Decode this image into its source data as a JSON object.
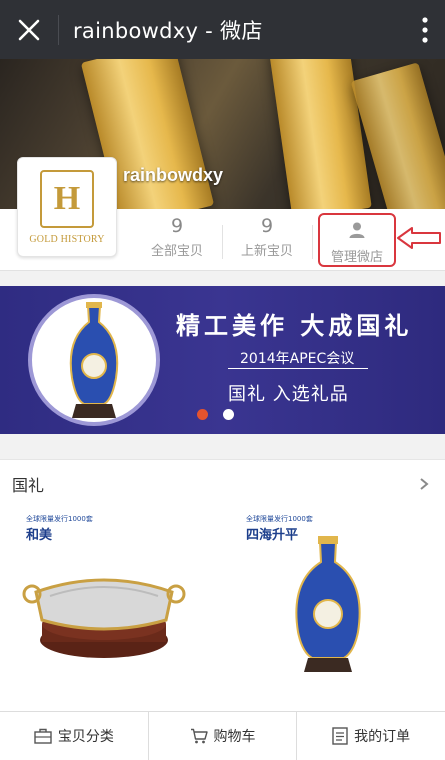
{
  "titlebar": {
    "title": "rainbowdxy - 微店"
  },
  "shop": {
    "name": "rainbowdxy",
    "logo_text": "GOLD HISTORY"
  },
  "stats": [
    {
      "value": "9",
      "label": "全部宝贝"
    },
    {
      "value": "9",
      "label": "上新宝贝"
    }
  ],
  "manage": {
    "label": "管理微店"
  },
  "banner": {
    "line1": "精工美作 大成国礼",
    "line2": "2014年APEC会议",
    "line3": "国礼 入选礼品",
    "active_slide": 1,
    "slide_count": 2
  },
  "section": {
    "title": "国礼",
    "products": [
      {
        "tag": "全球限量发行1000套",
        "name": "和美"
      },
      {
        "tag": "全球限量发行1000套",
        "name": "四海升平"
      }
    ]
  },
  "bottom_nav": [
    {
      "label": "宝贝分类"
    },
    {
      "label": "购物车"
    },
    {
      "label": "我的订单"
    }
  ],
  "colors": {
    "accent_red": "#d9363e",
    "banner_blue": "#312d85",
    "gold": "#c49a3a",
    "titlebar": "#2f3136"
  }
}
